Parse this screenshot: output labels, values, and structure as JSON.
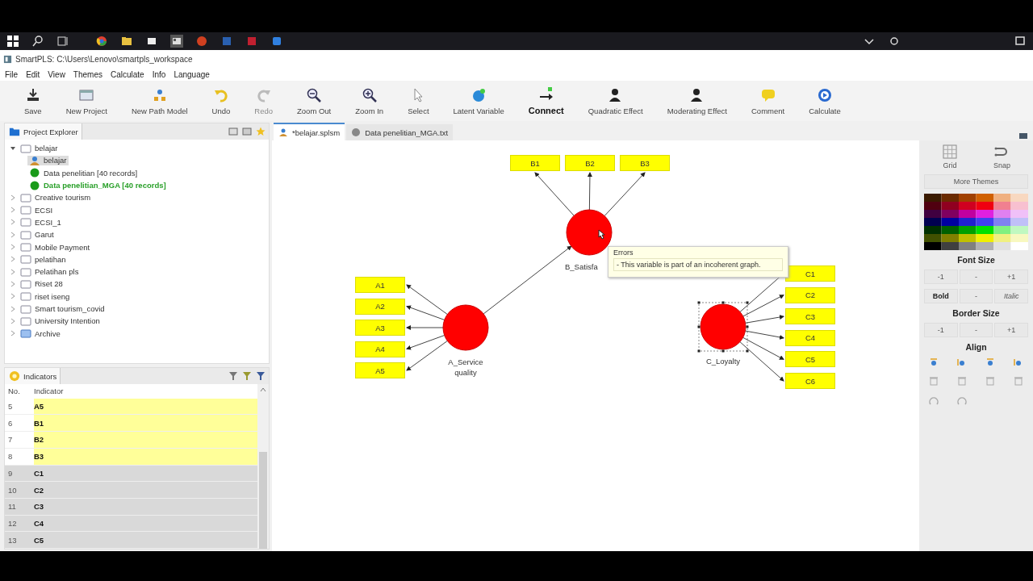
{
  "window": {
    "title": "SmartPLS: C:\\Users\\Lenovo\\smartpls_workspace"
  },
  "menu": [
    "File",
    "Edit",
    "View",
    "Themes",
    "Calculate",
    "Info",
    "Language"
  ],
  "toolbar": [
    {
      "label": "Save",
      "kind": "save",
      "disabled": false,
      "selected": false
    },
    {
      "label": "New Project",
      "kind": "project",
      "disabled": false,
      "selected": false
    },
    {
      "label": "New Path Model",
      "kind": "model",
      "disabled": false,
      "selected": false
    },
    {
      "label": "Undo",
      "kind": "undo",
      "disabled": false,
      "selected": false
    },
    {
      "label": "Redo",
      "kind": "redo",
      "disabled": true,
      "selected": false
    },
    {
      "label": "Zoom Out",
      "kind": "zoomout",
      "disabled": false,
      "selected": false
    },
    {
      "label": "Zoom In",
      "kind": "zoomin",
      "disabled": false,
      "selected": false
    },
    {
      "label": "Select",
      "kind": "select",
      "disabled": false,
      "selected": false
    },
    {
      "label": "Latent Variable",
      "kind": "latent",
      "disabled": false,
      "selected": false
    },
    {
      "label": "Connect",
      "kind": "connect",
      "disabled": false,
      "selected": true
    },
    {
      "label": "Quadratic Effect",
      "kind": "person",
      "disabled": false,
      "selected": false
    },
    {
      "label": "Moderating Effect",
      "kind": "person",
      "disabled": false,
      "selected": false
    },
    {
      "label": "Comment",
      "kind": "comment",
      "disabled": false,
      "selected": false
    },
    {
      "label": "Calculate",
      "kind": "calculate",
      "disabled": false,
      "selected": false
    }
  ],
  "project_explorer": {
    "title": "Project Explorer",
    "items": [
      {
        "label": "belajar",
        "kind": "project",
        "expanded": true,
        "selected": false,
        "children": [
          {
            "label": "belajar",
            "kind": "model",
            "selected": true,
            "active": false
          },
          {
            "label": "Data penelitian [40 records]",
            "kind": "data",
            "selected": false,
            "active": false
          },
          {
            "label": "Data penelitian_MGA [40 records]",
            "kind": "data",
            "selected": false,
            "active": true
          }
        ]
      },
      {
        "label": "Creative tourism",
        "kind": "project",
        "expanded": false,
        "selected": false
      },
      {
        "label": "ECSI",
        "kind": "project",
        "expanded": false,
        "selected": false
      },
      {
        "label": "ECSI_1",
        "kind": "project",
        "expanded": false,
        "selected": false
      },
      {
        "label": "Garut",
        "kind": "project",
        "expanded": false,
        "selected": false
      },
      {
        "label": "Mobile Payment",
        "kind": "project",
        "expanded": false,
        "selected": false
      },
      {
        "label": "pelatihan",
        "kind": "project",
        "expanded": false,
        "selected": false
      },
      {
        "label": "Pelatihan pls",
        "kind": "project",
        "expanded": false,
        "selected": false
      },
      {
        "label": "Riset 28",
        "kind": "project",
        "expanded": false,
        "selected": false
      },
      {
        "label": "riset iseng",
        "kind": "project",
        "expanded": false,
        "selected": false
      },
      {
        "label": "Smart tourism_covid",
        "kind": "project",
        "expanded": false,
        "selected": false
      },
      {
        "label": "University Intention",
        "kind": "project",
        "expanded": false,
        "selected": false
      },
      {
        "label": "Archive",
        "kind": "archive",
        "expanded": false,
        "selected": false
      }
    ]
  },
  "indicators": {
    "title": "Indicators",
    "columns": [
      "No.",
      "Indicator"
    ],
    "rows": [
      {
        "no": "5",
        "name": "A5",
        "highlighted": true
      },
      {
        "no": "6",
        "name": "B1",
        "highlighted": true
      },
      {
        "no": "7",
        "name": "B2",
        "highlighted": true
      },
      {
        "no": "8",
        "name": "B3",
        "highlighted": true
      },
      {
        "no": "9",
        "name": "C1",
        "highlighted": false
      },
      {
        "no": "10",
        "name": "C2",
        "highlighted": false
      },
      {
        "no": "11",
        "name": "C3",
        "highlighted": false
      },
      {
        "no": "12",
        "name": "C4",
        "highlighted": false
      },
      {
        "no": "13",
        "name": "C5",
        "highlighted": false
      }
    ]
  },
  "editor_tabs": [
    {
      "label": "*belajar.splsm",
      "selected": true
    },
    {
      "label": "Data penelitian_MGA.txt",
      "selected": false
    }
  ],
  "model": {
    "constructs": [
      {
        "name": "B_Satisfa",
        "selected": false,
        "indicators": [
          "B1",
          "B2",
          "B3"
        ]
      },
      {
        "name": "A_Service quality",
        "selected": false,
        "indicators": [
          "A1",
          "A2",
          "A3",
          "A4",
          "A5"
        ]
      },
      {
        "name": "C_Loyalty",
        "selected": true,
        "indicators": [
          "C1",
          "C2",
          "C3",
          "C4",
          "C5",
          "C6"
        ]
      }
    ],
    "tooltip": {
      "title": "Errors",
      "message": "- This variable is part of an incoherent graph."
    }
  },
  "palette": {
    "grid": "Grid",
    "snap": "Snap",
    "more_themes": "More Themes",
    "font_size": "Font Size",
    "font_buttons": [
      "-1",
      "-",
      "+1"
    ],
    "style_buttons": [
      "Bold",
      "-",
      "Italic"
    ],
    "border_size": "Border Size",
    "border_buttons": [
      "-1",
      "-",
      "+1"
    ],
    "align": "Align"
  }
}
